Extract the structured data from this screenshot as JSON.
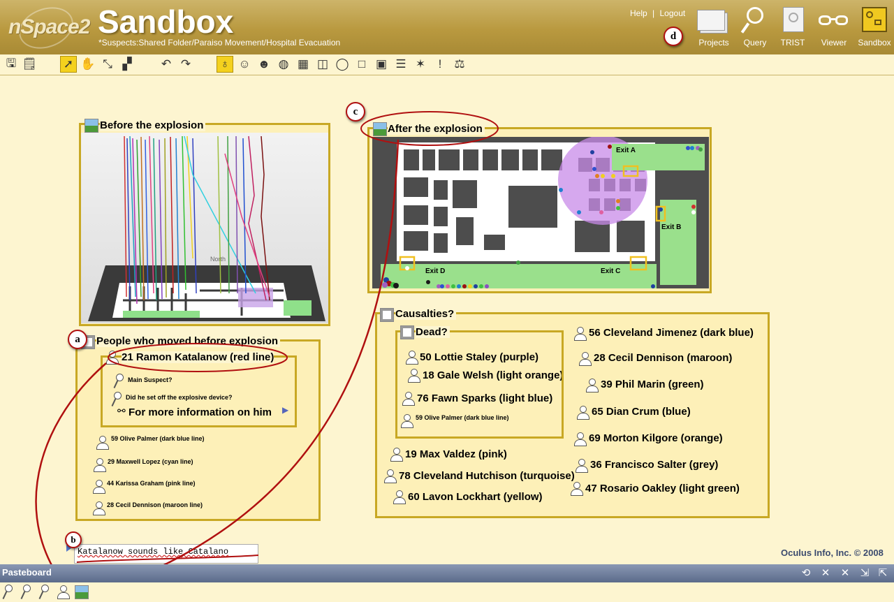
{
  "header": {
    "logo": "nSpace2",
    "title": "Sandbox",
    "breadcrumb": "*Suspects:Shared Folder/Paraiso Movement/Hospital Evacuation",
    "help": "Help",
    "separator": "|",
    "logout": "Logout",
    "nav": [
      {
        "label": "Projects",
        "icon": "projects-icon"
      },
      {
        "label": "Query",
        "icon": "query-icon"
      },
      {
        "label": "TRIST",
        "icon": "trist-icon"
      },
      {
        "label": "Viewer",
        "icon": "viewer-icon"
      },
      {
        "label": "Sandbox",
        "icon": "sandbox-icon"
      }
    ]
  },
  "annotations": {
    "a": "a",
    "b": "b",
    "c": "c",
    "d": "d"
  },
  "panels": {
    "before": {
      "title": "Before the explosion",
      "north": "North"
    },
    "after": {
      "title": "After the explosion",
      "exits": [
        "Exit A",
        "Exit B",
        "Exit C",
        "Exit D"
      ]
    },
    "people": {
      "title": "People who moved before explosion",
      "suspect": {
        "name": "21 Ramon Katalanow (red line)",
        "q1": "Main Suspect?",
        "q2": "Did he set off the explosive device?",
        "more": "For more information on him"
      },
      "others": [
        "59 Olive Palmer (dark blue line)",
        "29 Maxwell Lopez (cyan line)",
        "44 Karissa Graham (pink line)",
        "28 Cecil Dennison (maroon line)"
      ]
    },
    "casualties": {
      "title": "Causalties?",
      "dead_title": "Dead?",
      "dead": [
        "50 Lottie Staley (purple)",
        "18 Gale Welsh (light orange)",
        "76 Fawn Sparks (light blue)",
        "59 Olive Palmer (dark blue line)"
      ],
      "left_list": [
        "19 Max Valdez (pink)",
        "78 Cleveland Hutchison (turquoise)",
        "60 Lavon Lockhart (yellow)"
      ],
      "right_list": [
        "56 Cleveland Jimenez (dark blue)",
        "28 Cecil Dennison (maroon)",
        "39 Phil Marin (green)",
        "65 Dian Crum (blue)",
        "69 Morton Kilgore (orange)",
        "36 Francisco Salter (grey)",
        "47 Rosario Oakley (light green)"
      ]
    }
  },
  "note": "Katalanow sounds like Catalano",
  "copyright": "Oculus Info, Inc. © 2008",
  "pasteboard": {
    "label": "Pasteboard"
  },
  "colors": {
    "header": "#b9993f",
    "panel_border": "#c8a824",
    "panel_bg": "#fdf0b8",
    "annotation": "#b01010",
    "pasteboard_bar": "#5b6b8a"
  }
}
